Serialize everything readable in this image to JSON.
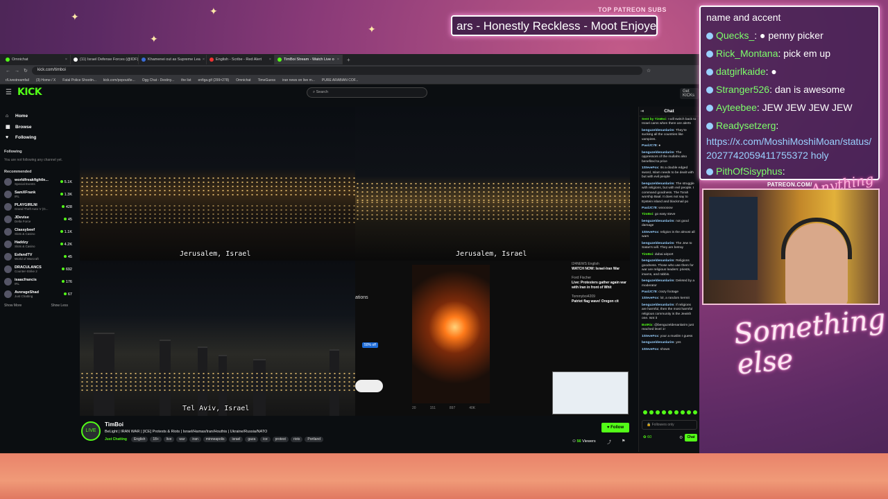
{
  "overlay": {
    "patreon_label": "TOP PATREON SUBS",
    "ticker_text": "ars - Honestly Reckless - Moot Enjoye",
    "patreon_url": "PATREON.COM/",
    "logo_text": "Anything Else",
    "something_else": "Something else",
    "chat_lines": [
      {
        "name": "",
        "text": "name and accent"
      },
      {
        "name": "Quecks_",
        "text": ": ● penny picker"
      },
      {
        "name": "Rick_Montana",
        "text": ": pick em up"
      },
      {
        "name": "datgirlkaide",
        "text": ": ●"
      },
      {
        "name": "Stranger526",
        "text": ": dan is awesome"
      },
      {
        "name": "Ayteebee",
        "text": ": JEW JEW JEW JEW"
      },
      {
        "name": "Readysetzerg",
        "text": ":"
      },
      {
        "name": "",
        "text": "https://x.com/MoshiMoshiMoan/status/2027742059411755372 holy"
      },
      {
        "name": "PithOfSisyphus",
        "text": ":"
      }
    ]
  },
  "browser": {
    "tabs": [
      {
        "label": "Omnichat",
        "active": false
      },
      {
        "label": "(11) Israel Defense Forces (@IDF)",
        "active": false
      },
      {
        "label": "Khamenei out as Supreme Lea",
        "active": false
      },
      {
        "label": "English - Scribe - Red Alert",
        "active": false
      },
      {
        "label": "TimBoi Stream - Watch Live o",
        "active": true
      }
    ],
    "new_tab": "+",
    "url": "kick.com/timboi",
    "bookmarks": [
      "r/Livestreamfail",
      "(3) Home / X",
      "Fatal Police Shootin...",
      "kick.com/popout/te...",
      "Ogg Chat - Destiny...",
      "the list",
      "enfiga.gif (299×278)",
      "Omnichat",
      "TimeGuess",
      "iran news on live m...",
      "PURE ARABIAN COF..."
    ]
  },
  "kick": {
    "logo": "KICK",
    "search_placeholder": "Search",
    "get_kicks": "Get KICKs",
    "nav": [
      {
        "label": "Home",
        "icon": "⌂"
      },
      {
        "label": "Browse",
        "icon": "▦"
      },
      {
        "label": "Following",
        "icon": "♥"
      }
    ],
    "following_label": "Following",
    "following_empty": "You are not following any channel yet.",
    "recommended_label": "Recommended",
    "recommended": [
      {
        "name": "worldfreakfightle...",
        "category": "Special Events",
        "viewers": "5.1K"
      },
      {
        "name": "SamXFrank",
        "category": "IRL",
        "viewers": "1.3K"
      },
      {
        "name": "PLAYGIRLNI",
        "category": "Grand Theft Auto V (G...",
        "viewers": "428"
      },
      {
        "name": "JDevise",
        "category": "Delta Force",
        "viewers": "45"
      },
      {
        "name": "Classybeef",
        "category": "Slots & Casino",
        "viewers": "1.1K"
      },
      {
        "name": "Haddzy",
        "category": "Slots & Casino",
        "viewers": "4.2K"
      },
      {
        "name": "EsfandTV",
        "category": "World of Warcraft",
        "viewers": "45"
      },
      {
        "name": "DRACULANCS",
        "category": "Counter-Strike 2",
        "viewers": "692"
      },
      {
        "name": "isaacfrancis",
        "category": "IRL",
        "viewers": "176"
      },
      {
        "name": "AverageShad",
        "category": "Just Chatting",
        "viewers": "67"
      }
    ],
    "show_more": "Show More",
    "show_less": "Show Less"
  },
  "video": {
    "cam1_label": "Jerusalem, Israel",
    "cam2_label": "Jerusalem, Israel",
    "cam3_label": "Tel Aviv, Israel",
    "social_fragment": "ations",
    "badge": "50% off",
    "tweet_stats": [
      "20",
      "151",
      "897",
      "40K"
    ],
    "feed": [
      {
        "handle": "I24NEWS English",
        "text": "WATCH NOW: Israel-Iran War"
      },
      {
        "handle": "Ford Fischer",
        "text": "Live: Protesters gather again war with Iran in front of Whit"
      },
      {
        "handle": "Tommyboi4209",
        "text": "Patriot flag wave! Oregon cit"
      }
    ]
  },
  "stream": {
    "streamer": "TimBoi",
    "avatar_text": "LIVE",
    "title": "BeLight | IRAN WAR | [ICE] Protests & Riots |  Israel/Hamas/Iran/Houthis | Ukraine/Russia/NATO",
    "category": "Just Chatting",
    "tags": [
      "English",
      "18+",
      "live",
      "war",
      "iran",
      "minneapolis",
      "israel",
      "gaza",
      "ice",
      "protest",
      "riots",
      "Portland"
    ],
    "follow": "Follow",
    "viewers": "56",
    "viewers_label": "Viewers"
  },
  "chat": {
    "title": "Chat",
    "messages": [
      {
        "user": "Sent by TimBoi",
        "text": "I will switch back to Israel cams when there are alerts",
        "green": true
      },
      {
        "user": "benguzeldenanlarim",
        "text": "They're sucking all the countries like vampires.",
        "green": false
      },
      {
        "user": "PaulJC78",
        "text": "●",
        "green": false
      },
      {
        "user": "benguzeldenanlarim",
        "text": "The oppressors of the mullahs also benefited ta price",
        "green": false
      },
      {
        "user": "1SteveFox",
        "text": "Its a double edged sword, Islam needs to be dealt with but with evil people",
        "green": false
      },
      {
        "user": "benguzeldenanlarim",
        "text": "The struggle with religions, but with evil people. I command goodness. The Torah worship Baal. It does not say to Epstein island and blackmail po",
        "green": false
      },
      {
        "user": "PaulJC78",
        "text": "wooooow",
        "green": false
      },
      {
        "user": "TimBoi",
        "text": "go easy steve",
        "green": true
      },
      {
        "user": "benguzeldenanlarim",
        "text": "not good damage",
        "green": false
      },
      {
        "user": "1SteveFox",
        "text": "religion is the almost all wars",
        "green": false
      },
      {
        "user": "benguzeldenanlarim",
        "text": "The Jew to Satan's will. They are betray",
        "green": false
      },
      {
        "user": "TimBoi",
        "text": "dubai airport",
        "green": true
      },
      {
        "user": "benguzeldenanlarim",
        "text": "Religions goodness. Those who use them for war are religious leaders: priests, imams, and rabbis.",
        "green": false
      },
      {
        "user": "benguzeldenanlarim",
        "text": "Deleted by a moderator",
        "green": false
      },
      {
        "user": "PaulJC78",
        "text": "crazy footage",
        "green": false
      },
      {
        "user": "1SteveFox",
        "text": "lol, a random kermit",
        "green": false
      },
      {
        "user": "benguzeldenanlarim",
        "text": "If religions are harmful, then the most harmful religious community is the Jewish one. Isnt it",
        "green": false
      },
      {
        "user": "BotRix",
        "text": "@benguzeldenanlarim just reached level 1!",
        "green": true
      },
      {
        "user": "1SteveFox",
        "text": "your a muslim I guess",
        "green": false
      },
      {
        "user": "benguzeldenanlarim",
        "text": "yes",
        "green": false
      },
      {
        "user": "1SteveFox",
        "text": "shows",
        "green": false
      }
    ],
    "input_placeholder": "Followers only",
    "points": "60",
    "send": "Chat"
  }
}
